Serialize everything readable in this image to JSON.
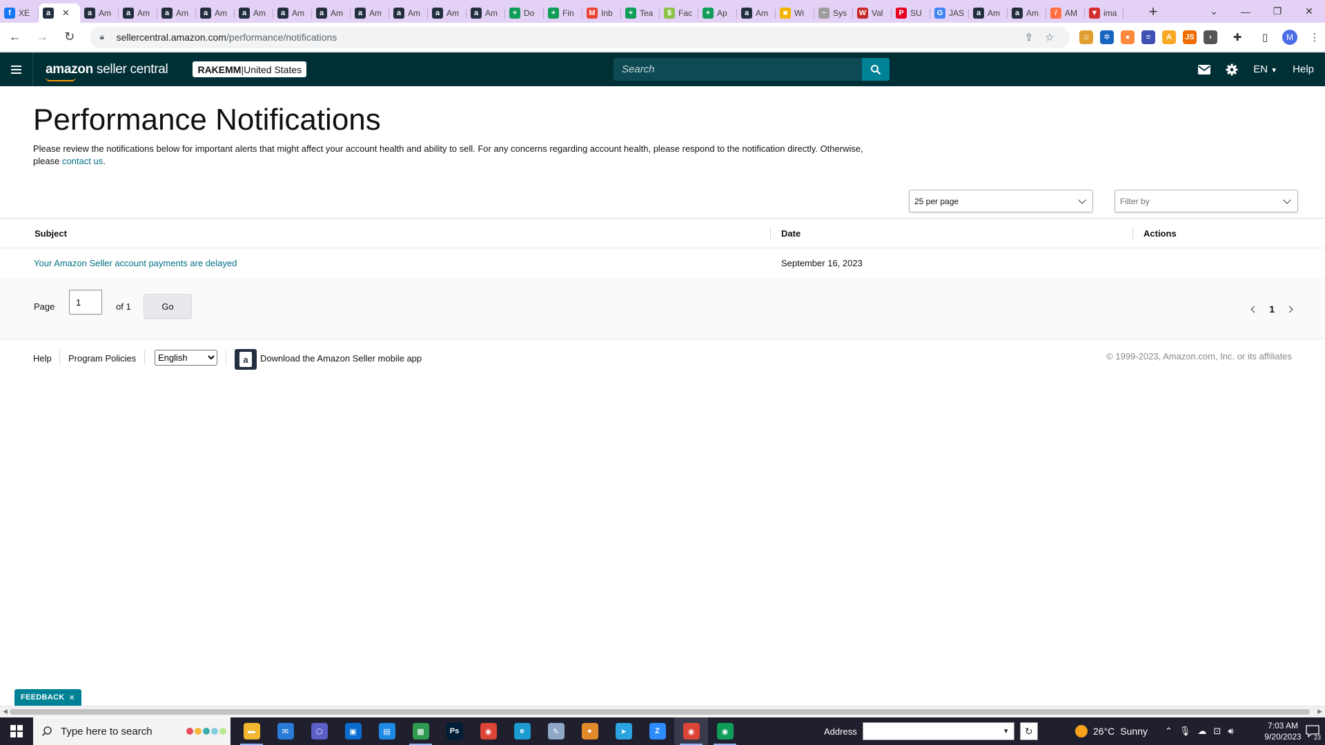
{
  "browser": {
    "tabs": [
      {
        "label": "XE",
        "color": "#1877f2",
        "glyph": "f"
      },
      {
        "label": "",
        "color": "#232f3e",
        "glyph": "a",
        "active": true
      },
      {
        "label": "Am",
        "color": "#232f3e",
        "glyph": "a"
      },
      {
        "label": "Am",
        "color": "#232f3e",
        "glyph": "a"
      },
      {
        "label": "Am",
        "color": "#232f3e",
        "glyph": "a"
      },
      {
        "label": "Am",
        "color": "#232f3e",
        "glyph": "a"
      },
      {
        "label": "Am",
        "color": "#232f3e",
        "glyph": "a"
      },
      {
        "label": "Am",
        "color": "#232f3e",
        "glyph": "a"
      },
      {
        "label": "Am",
        "color": "#232f3e",
        "glyph": "a"
      },
      {
        "label": "Am",
        "color": "#232f3e",
        "glyph": "a"
      },
      {
        "label": "Am",
        "color": "#232f3e",
        "glyph": "a"
      },
      {
        "label": "Am",
        "color": "#232f3e",
        "glyph": "a"
      },
      {
        "label": "Am",
        "color": "#232f3e",
        "glyph": "a"
      },
      {
        "label": "Do",
        "color": "#0f9d58",
        "glyph": "+"
      },
      {
        "label": "Fin",
        "color": "#0f9d58",
        "glyph": "+"
      },
      {
        "label": "Inb",
        "color": "#ea4335",
        "glyph": "M"
      },
      {
        "label": "Tea",
        "color": "#0f9d58",
        "glyph": "+"
      },
      {
        "label": "Fac",
        "color": "#8bc34a",
        "glyph": "$"
      },
      {
        "label": "Ap",
        "color": "#0f9d58",
        "glyph": "+"
      },
      {
        "label": "Am",
        "color": "#232f3e",
        "glyph": "a"
      },
      {
        "label": "Wi",
        "color": "#f4b400",
        "glyph": "■"
      },
      {
        "label": "Sys",
        "color": "#9e9e9e",
        "glyph": "~"
      },
      {
        "label": "Val",
        "color": "#c62828",
        "glyph": "W"
      },
      {
        "label": "SU",
        "color": "#e60023",
        "glyph": "P"
      },
      {
        "label": "JAS",
        "color": "#4285f4",
        "glyph": "G"
      },
      {
        "label": "Am",
        "color": "#232f3e",
        "glyph": "a"
      },
      {
        "label": "Am",
        "color": "#232f3e",
        "glyph": "a"
      },
      {
        "label": "AM",
        "color": "#ff7043",
        "glyph": "/"
      },
      {
        "label": "ima",
        "color": "#d32f2f",
        "glyph": "▼"
      }
    ],
    "url_host": "sellercentral.amazon.com",
    "url_path": "/performance/notifications",
    "profile_initial": "M",
    "extensions": [
      {
        "color": "#e0a030",
        "glyph": "☺"
      },
      {
        "color": "#1565c0",
        "glyph": "✲"
      },
      {
        "color": "#ff8a3d",
        "glyph": "●"
      },
      {
        "color": "#3f51b5",
        "glyph": "≡"
      },
      {
        "color": "#f9a825",
        "glyph": "A"
      },
      {
        "color": "#ef6c00",
        "glyph": "JS"
      },
      {
        "color": "#555555",
        "glyph": "›"
      }
    ]
  },
  "header": {
    "brand_bold": "amazon",
    "brand_rest": " seller central",
    "store_name": "RAKEMM",
    "store_sep": " | ",
    "store_region": "United States",
    "search_placeholder": "Search",
    "lang": "EN",
    "help": "Help"
  },
  "page": {
    "title": "Performance Notifications",
    "intro": "Please review the notifications below for important alerts that might affect your account health and ability to sell. For any concerns regarding account health, please respond to the notification directly. Otherwise, please ",
    "intro_link": "contact us",
    "intro_end": ".",
    "per_page": "25 per page",
    "filter_placeholder": "Filter by"
  },
  "table": {
    "headers": {
      "subject": "Subject",
      "date": "Date",
      "actions": "Actions"
    },
    "rows": [
      {
        "subject": "Your Amazon Seller account payments are delayed",
        "date": "September 16, 2023",
        "actions": ""
      }
    ]
  },
  "pagination": {
    "page_label": "Page",
    "current": "1",
    "of_label": "of 1",
    "go": "Go",
    "current_page_num": "1"
  },
  "footer": {
    "help": "Help",
    "policies": "Program Policies",
    "language": "English",
    "app_text": "Download the Amazon Seller mobile app",
    "copyright": "© 1999-2023, Amazon.com, Inc. or its affiliates"
  },
  "feedback": {
    "label": "FEEDBACK",
    "close": "✕"
  },
  "taskbar": {
    "search_placeholder": "Type here to search",
    "address_label": "Address",
    "weather_temp": "26°C",
    "weather_desc": "Sunny",
    "time": "7:03 AM",
    "date": "9/20/2023",
    "notif_count": "23",
    "apps": [
      {
        "name": "file-explorer",
        "color": "#f2b630",
        "glyph": "▬",
        "open": true
      },
      {
        "name": "mail",
        "color": "#2a7ad8",
        "glyph": "✉"
      },
      {
        "name": "app-hex",
        "color": "#5b5fc7",
        "glyph": "⬡"
      },
      {
        "name": "store",
        "color": "#0a6ccf",
        "glyph": "▣"
      },
      {
        "name": "app-window",
        "color": "#1e88e5",
        "glyph": "▤"
      },
      {
        "name": "calculator",
        "color": "#2f9a50",
        "glyph": "▦",
        "open": true
      },
      {
        "name": "photoshop",
        "color": "#001e36",
        "glyph": "Ps"
      },
      {
        "name": "chrome",
        "color": "#db4437",
        "glyph": "◉"
      },
      {
        "name": "edge",
        "color": "#1c9bd1",
        "glyph": "e"
      },
      {
        "name": "app-pen",
        "color": "#8fa8c8",
        "glyph": "✎"
      },
      {
        "name": "app-orange",
        "color": "#e08a2c",
        "glyph": "●"
      },
      {
        "name": "telegram",
        "color": "#2aa3e0",
        "glyph": "➤"
      },
      {
        "name": "zoom",
        "color": "#2d8cff",
        "glyph": "Z"
      },
      {
        "name": "chrome-profile-1",
        "color": "#db4437",
        "glyph": "◉",
        "open": true,
        "active": true
      },
      {
        "name": "chrome-profile-2",
        "color": "#0f9d58",
        "glyph": "◉",
        "open": true
      }
    ]
  }
}
